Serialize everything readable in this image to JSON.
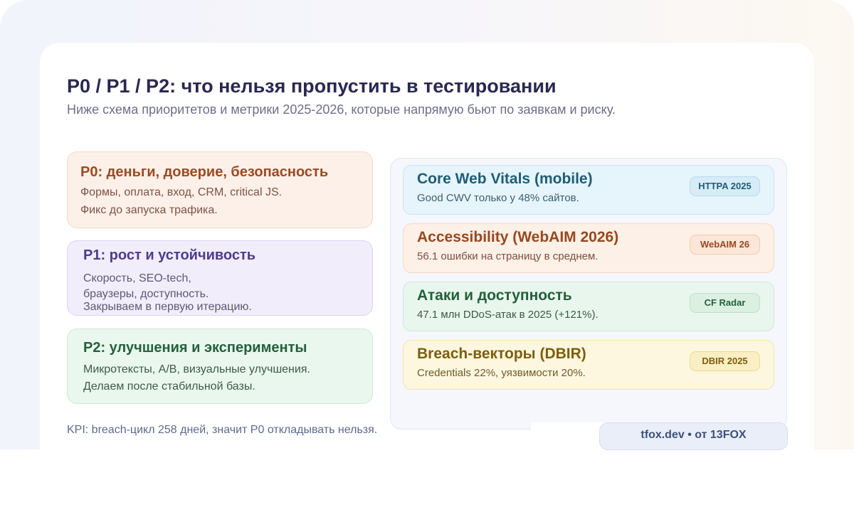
{
  "header": {
    "title": "P0 / P1 / P2: что нельзя пропустить в тестировании",
    "subtitle": "Ниже схема приоритетов и метрики 2025-2026, которые напрямую бьют по заявкам и риску."
  },
  "priorities": [
    {
      "heading": "P0: деньги, доверие, безопасность",
      "lines": [
        "Формы, оплата, вход, CRM, critical JS.",
        "Фикс до запуска трафика."
      ]
    },
    {
      "heading": "P1: рост и устойчивость",
      "lines": [
        "Скорость, SEO-tech,",
        "браузеры, доступность.",
        "Закрываем в первую итерацию."
      ]
    },
    {
      "heading": "P2: улучшения и эксперименты",
      "lines": [
        "Микротексты, A/B, визуальные улучшения.",
        "Делаем после стабильной базы."
      ]
    }
  ],
  "metrics": [
    {
      "heading": "Core Web Vitals (mobile)",
      "text": "Good CWV только у 48% сайтов.",
      "badge": "HTTPA 2025"
    },
    {
      "heading": "Accessibility (WebAIM 2026)",
      "text": "56.1 ошибки на страницу в среднем.",
      "badge": "WebAIM 26"
    },
    {
      "heading": "Атаки и доступность",
      "text": "47.1 млн DDoS-атак в 2025 (+121%).",
      "badge": "CF Radar"
    },
    {
      "heading": "Breach-векторы (DBIR)",
      "text": "Credentials 22%, уязвимости 20%.",
      "badge": "DBIR 2025"
    }
  ],
  "footer": {
    "kpi": "KPI: breach-цикл 258 дней, значит P0 откладывать нельзя.",
    "brand": "tfox.dev • от 13FOX"
  }
}
